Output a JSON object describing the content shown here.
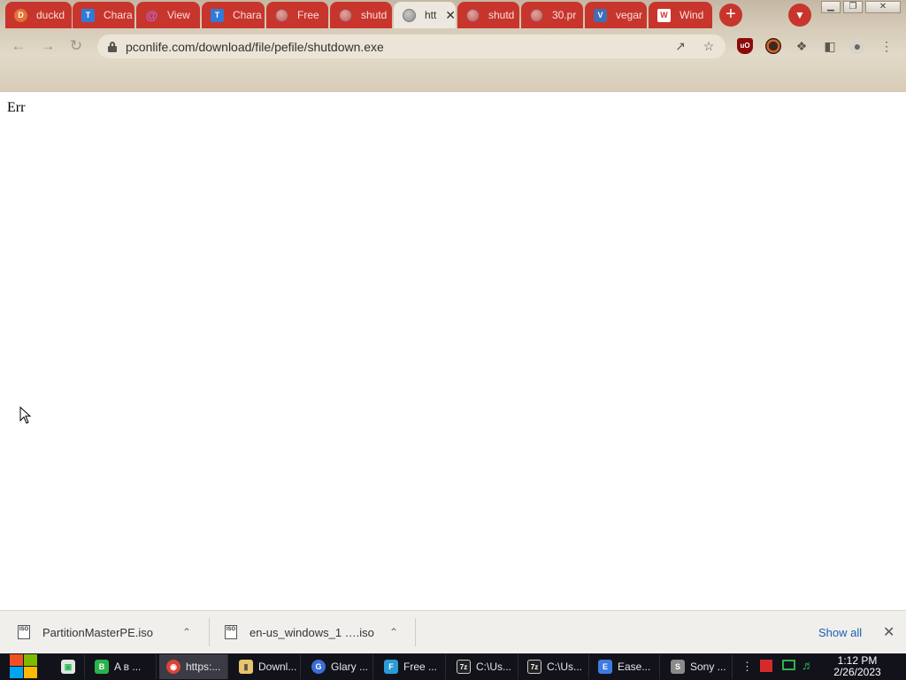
{
  "tabs": [
    {
      "title": "duckd",
      "icon": "duckduckgo-icon",
      "active": false
    },
    {
      "title": "Chara",
      "icon": "charmap-icon",
      "active": false
    },
    {
      "title": "View",
      "icon": "at-sign-icon",
      "active": false
    },
    {
      "title": "Chara",
      "icon": "charmap-icon",
      "active": false
    },
    {
      "title": "Free",
      "icon": "globe-icon",
      "active": false
    },
    {
      "title": "shutd",
      "icon": "globe-icon",
      "active": false
    },
    {
      "title": "htt",
      "icon": "globe-icon",
      "active": true
    },
    {
      "title": "shutd",
      "icon": "globe-icon",
      "active": false
    },
    {
      "title": "30.pr",
      "icon": "globe-icon",
      "active": false
    },
    {
      "title": "vegar",
      "icon": "vegas-icon",
      "active": false
    },
    {
      "title": "Wind",
      "icon": "windows-site-icon",
      "active": false
    }
  ],
  "toolbar": {
    "url": "pconlife.com/download/file/pefile/shutdown.exe"
  },
  "page": {
    "body_text": "Err"
  },
  "downloads": {
    "items": [
      {
        "filename": "PartitionMasterPE.iso",
        "icon_label": "ISO"
      },
      {
        "filename": "en-us_windows_1 ….iso",
        "icon_label": "ISO"
      }
    ],
    "show_all": "Show all"
  },
  "taskbar": {
    "items": [
      {
        "label": "A в ...",
        "icon": "green-app-icon",
        "color": "#2bb24c"
      },
      {
        "label": "https:...",
        "icon": "chrome-icon",
        "color": "#db4437"
      },
      {
        "label": "Downl...",
        "icon": "folder-icon",
        "color": "#e9c46a"
      },
      {
        "label": "Glary ...",
        "icon": "glary-icon",
        "color": "#3a6fd8"
      },
      {
        "label": "Free ...",
        "icon": "free-app-icon",
        "color": "#2a9bd6"
      },
      {
        "label": "C:\\Us...",
        "icon": "7zip-icon",
        "color": "#222222"
      },
      {
        "label": "C:\\Us...",
        "icon": "7zip-icon",
        "color": "#222222"
      },
      {
        "label": "Ease...",
        "icon": "easeus-icon",
        "color": "#3d7be0"
      },
      {
        "label": "Sony ...",
        "icon": "sony-icon",
        "color": "#8a8a8a"
      }
    ],
    "clock": {
      "time": "1:12 PM",
      "date": "2/26/2023"
    }
  },
  "colors": {
    "tab_red": "#c8352c",
    "active_tab": "#ede8df",
    "link_blue": "#1a5fb4",
    "taskbar": "#11121a"
  }
}
